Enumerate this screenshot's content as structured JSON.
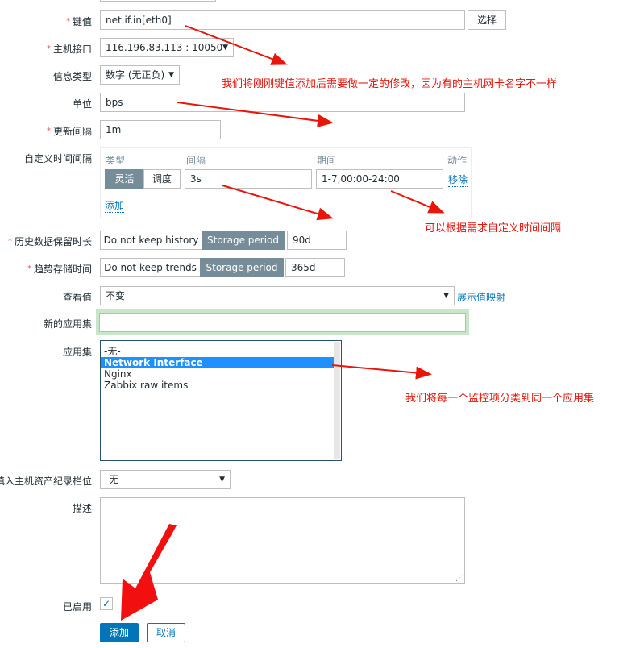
{
  "form": {
    "key": {
      "label": "键值",
      "required": true,
      "value": "net.if.in[eth0]",
      "select_button": "选择"
    },
    "host_interface": {
      "label": "主机接口",
      "required": true,
      "value": "116.196.83.113 : 10050"
    },
    "info_type": {
      "label": "信息类型",
      "required": false,
      "value": "数字 (无正负)"
    },
    "units": {
      "label": "单位",
      "required": false,
      "value": "bps"
    },
    "update_interval": {
      "label": "更新间隔",
      "required": true,
      "value": "1m"
    },
    "custom_intervals": {
      "label": "自定义时间间隔",
      "headers": {
        "type": "类型",
        "interval": "间隔",
        "period": "期间",
        "action": "动作"
      },
      "rows": [
        {
          "type_options": [
            "灵活",
            "调度"
          ],
          "type_selected": "灵活",
          "interval": "3s",
          "period": "1-7,00:00-24:00",
          "action": "移除"
        }
      ],
      "add_link": "添加"
    },
    "history": {
      "label": "历史数据保留时长",
      "required": true,
      "options": [
        "Do not keep history",
        "Storage period"
      ],
      "selected": "Storage period",
      "value": "90d"
    },
    "trends": {
      "label": "趋势存储时间",
      "required": true,
      "options": [
        "Do not keep trends",
        "Storage period"
      ],
      "selected": "Storage period",
      "value": "365d"
    },
    "show_value": {
      "label": "查看值",
      "value": "不变",
      "mapping_link": "展示值映射"
    },
    "new_application": {
      "label": "新的应用集",
      "value": ""
    },
    "applications": {
      "label": "应用集",
      "items": [
        "-无-",
        "Network Interface",
        "Nginx",
        "Zabbix raw items"
      ],
      "selected": "Network Interface"
    },
    "inventory_field": {
      "label": "填入主机资产纪录栏位",
      "value": "-无-"
    },
    "description": {
      "label": "描述",
      "value": ""
    },
    "enabled": {
      "label": "已启用",
      "checked": true
    },
    "buttons": {
      "add": "添加",
      "cancel": "取消"
    }
  },
  "annotations": {
    "key_note": "我们将刚刚键值添加后需要做一定的修改，因为有的主机网卡名字不一样",
    "interval_note": "可以根据需求自定义时间间隔",
    "application_note": "我们将每一个监控项分类到同一个应用集"
  },
  "colors": {
    "accent": "#0275b8",
    "segment_active": "#768d99",
    "annotation": "#e8150b",
    "selected_item": "#1e90ff",
    "focus_border": "#c8e6c9"
  }
}
